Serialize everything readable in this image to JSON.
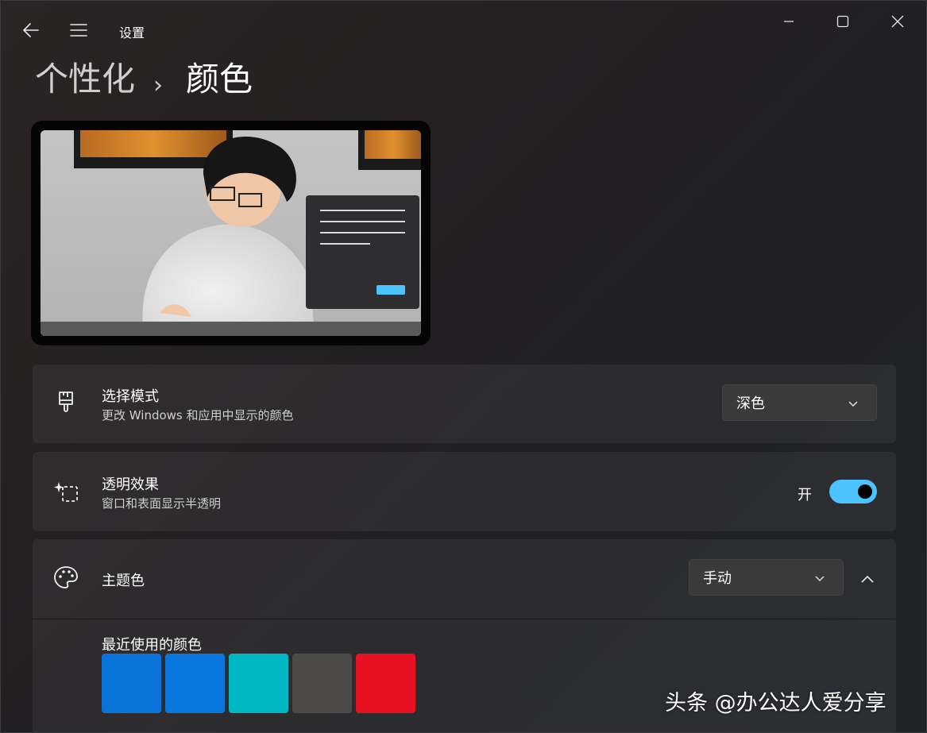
{
  "window": {
    "title": "设置",
    "controls": [
      "minimize-icon",
      "maximize-icon",
      "close-icon"
    ]
  },
  "titlebar": {
    "back_icon": "back-arrow-icon",
    "menu_icon": "hamburger-menu-icon"
  },
  "breadcrumb": {
    "parent": "个性化",
    "separator": "›",
    "current": "颜色"
  },
  "settings": {
    "mode": {
      "title": "选择模式",
      "subtitle": "更改 Windows 和应用中显示的颜色",
      "selected": "深色",
      "icon": "paintbrush-icon"
    },
    "transparency": {
      "title": "透明效果",
      "subtitle": "窗口和表面显示半透明",
      "state_label": "开",
      "on": true,
      "icon": "sparkle-selection-icon"
    },
    "accent": {
      "title": "主题色",
      "selected": "手动",
      "icon": "palette-icon",
      "expanded": true,
      "recent_label": "最近使用的颜色",
      "recent_colors": [
        "#0a74da",
        "#0a77de",
        "#00b7c3",
        "#4c4a48",
        "#e81123"
      ]
    }
  },
  "colors": {
    "accent": "#4cc2ff"
  },
  "watermark": "头条 @办公达人爱分享"
}
